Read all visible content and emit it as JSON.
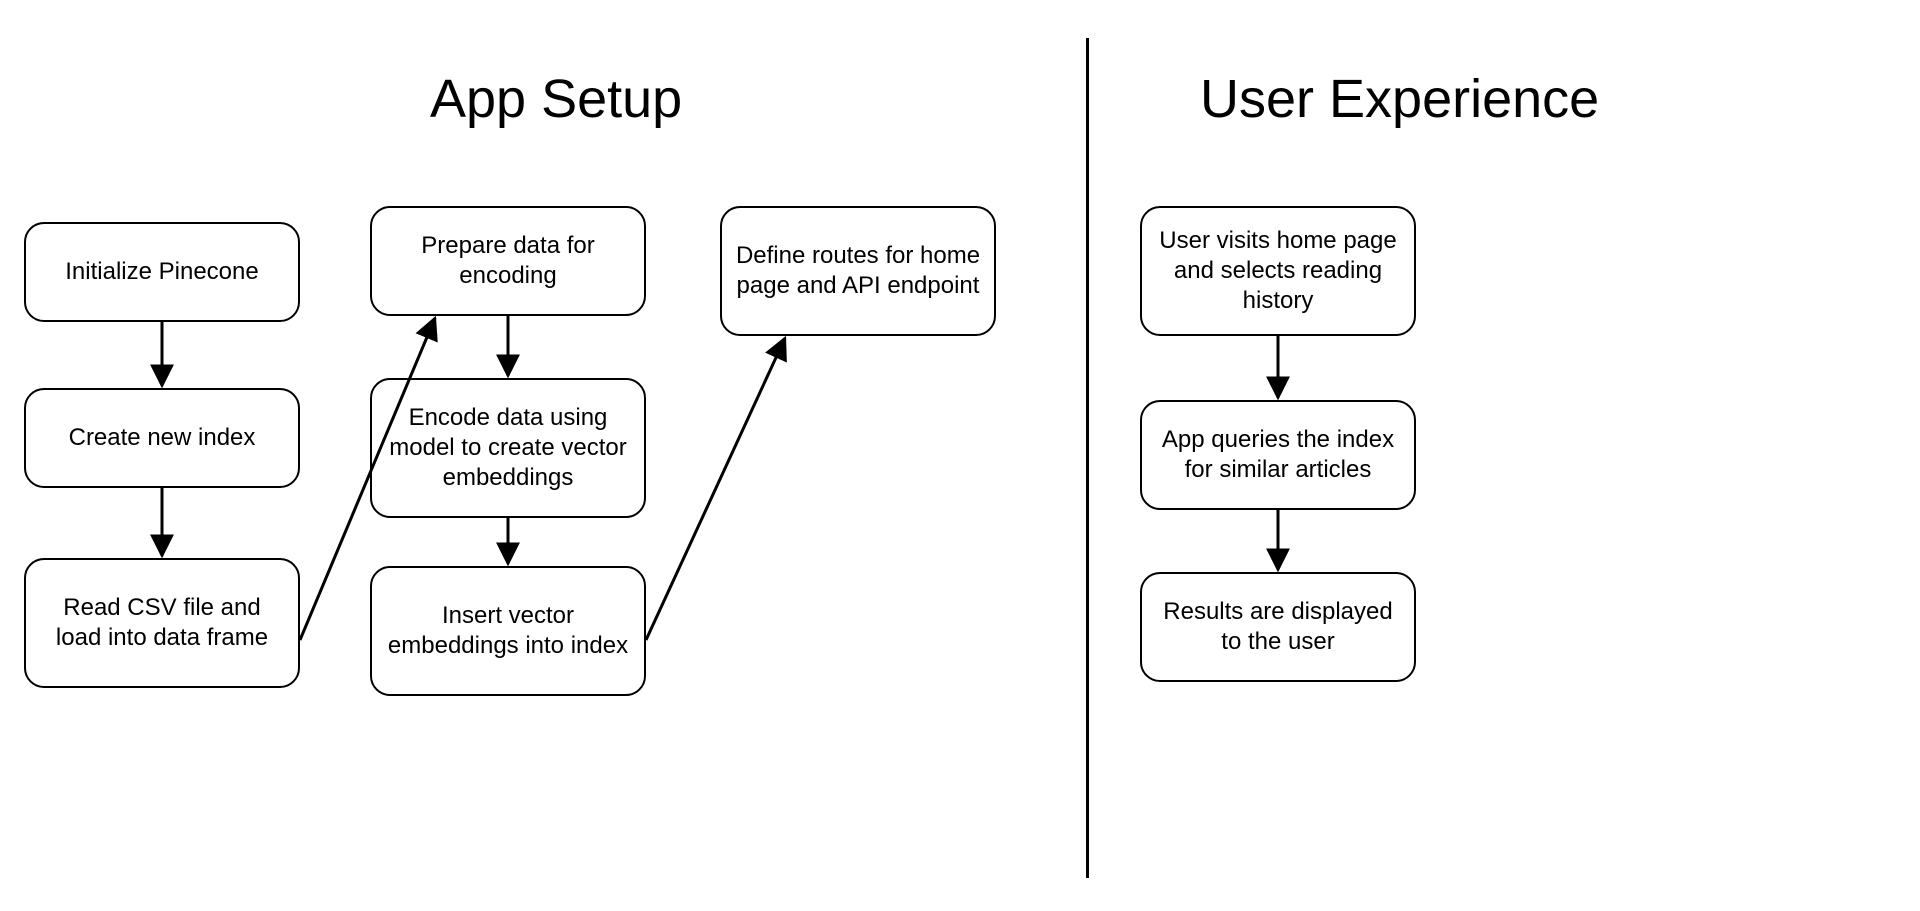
{
  "titles": {
    "left": "App Setup",
    "right": "User Experience"
  },
  "nodes": {
    "init_pinecone": "Initialize Pinecone",
    "create_index": "Create new index",
    "read_csv": "Read CSV file and load into data frame",
    "prepare_data": "Prepare data for encoding",
    "encode_data": "Encode data using model to create vector embeddings",
    "insert_vectors": "Insert vector embeddings into index",
    "define_routes": "Define routes for home page and API endpoint",
    "user_visits": "User visits home page and selects reading history",
    "app_queries": "App queries the index for similar articles",
    "results_displayed": "Results are displayed to the user"
  }
}
